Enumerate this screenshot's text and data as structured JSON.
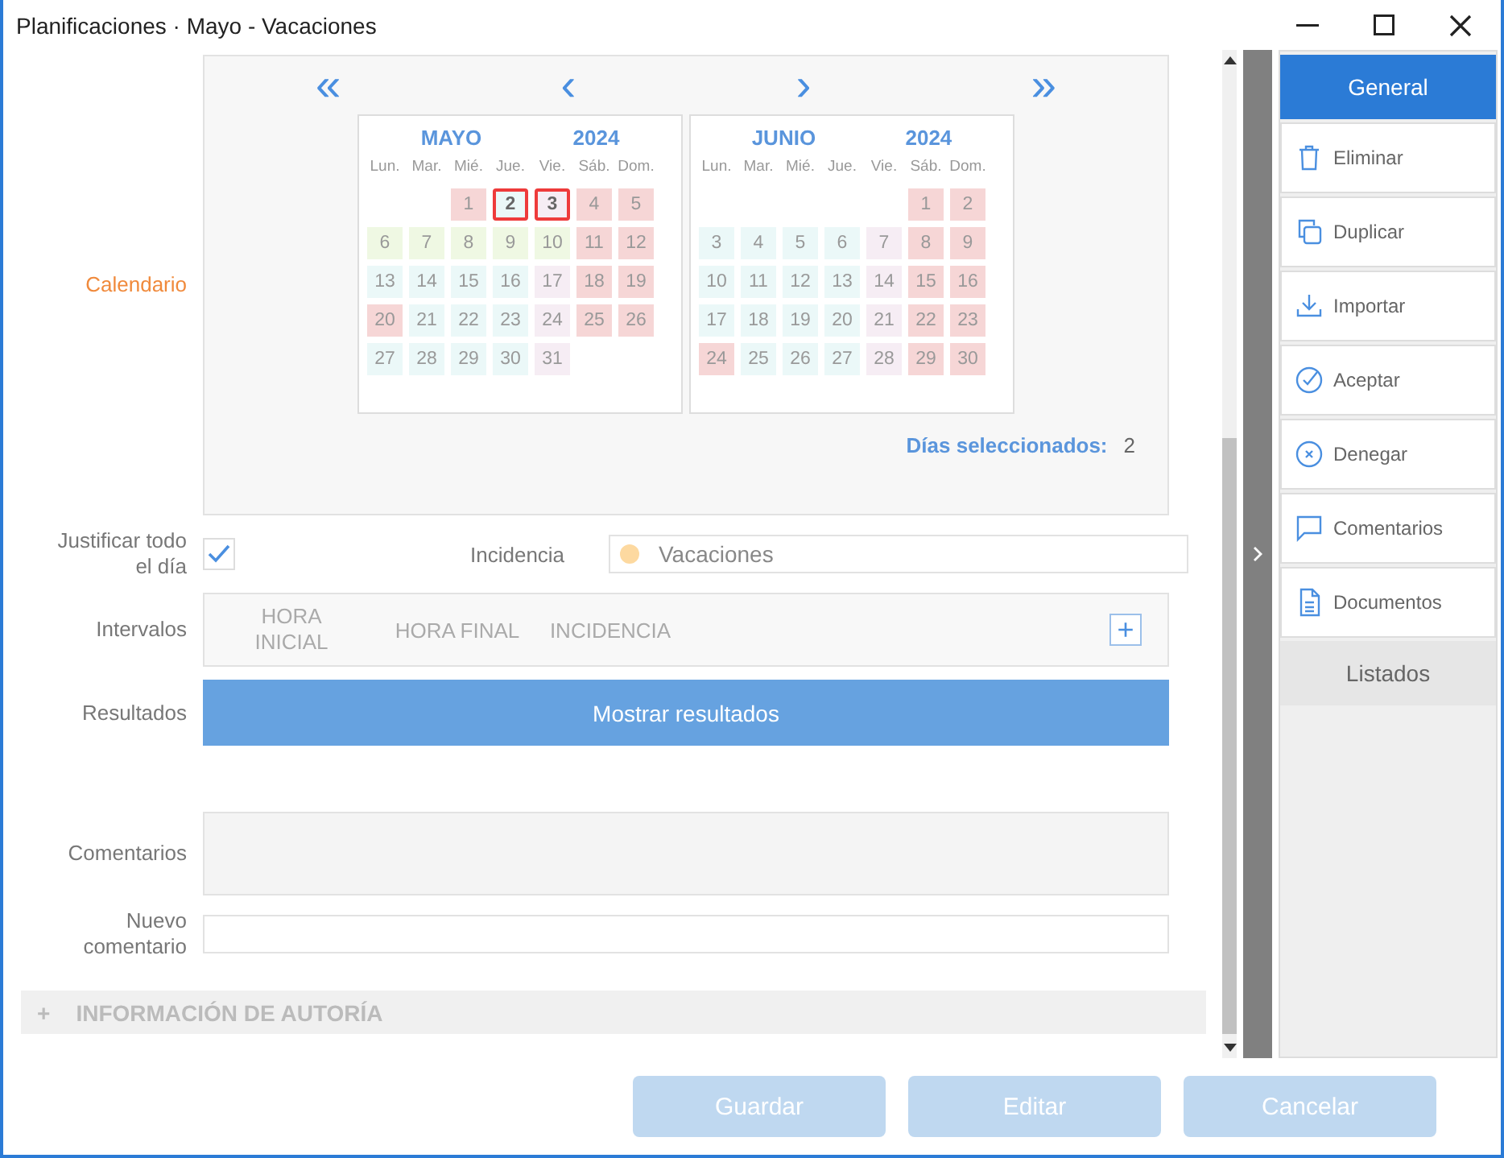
{
  "window": {
    "title": "Planificaciones · Mayo - Vacaciones"
  },
  "calendar": {
    "label": "Calendario",
    "nav": [
      "«",
      "‹",
      "›",
      "»"
    ],
    "months": [
      {
        "month": "MAYO",
        "year": "2024",
        "weekdays": [
          "Lun.",
          "Mar.",
          "Mié.",
          "Jue.",
          "Vie.",
          "Sáb.",
          "Dom."
        ],
        "cells": [
          {
            "kind": "empty"
          },
          {
            "kind": "empty"
          },
          {
            "kind": "day",
            "d": "1",
            "color": "#f6d6d6",
            "selected": false
          },
          {
            "kind": "day",
            "d": "2",
            "color": "#ebf8f8",
            "selected": true
          },
          {
            "kind": "day",
            "d": "3",
            "color": "#f6edf4",
            "selected": true
          },
          {
            "kind": "day",
            "d": "4",
            "color": "#f6d6d6",
            "selected": false
          },
          {
            "kind": "day",
            "d": "5",
            "color": "#f6d6d6",
            "selected": false
          },
          {
            "kind": "day",
            "d": "6",
            "color": "#eff8e3",
            "selected": false
          },
          {
            "kind": "day",
            "d": "7",
            "color": "#eff8e3",
            "selected": false
          },
          {
            "kind": "day",
            "d": "8",
            "color": "#eff8e3",
            "selected": false
          },
          {
            "kind": "day",
            "d": "9",
            "color": "#eff8e3",
            "selected": false
          },
          {
            "kind": "day",
            "d": "10",
            "color": "#eff8e3",
            "selected": false
          },
          {
            "kind": "day",
            "d": "11",
            "color": "#f6d6d6",
            "selected": false
          },
          {
            "kind": "day",
            "d": "12",
            "color": "#f6d6d6",
            "selected": false
          },
          {
            "kind": "day",
            "d": "13",
            "color": "#ebf8f8",
            "selected": false
          },
          {
            "kind": "day",
            "d": "14",
            "color": "#ebf8f8",
            "selected": false
          },
          {
            "kind": "day",
            "d": "15",
            "color": "#ebf8f8",
            "selected": false
          },
          {
            "kind": "day",
            "d": "16",
            "color": "#ebf8f8",
            "selected": false
          },
          {
            "kind": "day",
            "d": "17",
            "color": "#f6edf4",
            "selected": false
          },
          {
            "kind": "day",
            "d": "18",
            "color": "#f6d6d6",
            "selected": false
          },
          {
            "kind": "day",
            "d": "19",
            "color": "#f6d6d6",
            "selected": false
          },
          {
            "kind": "day",
            "d": "20",
            "color": "#f6d6d6",
            "selected": false
          },
          {
            "kind": "day",
            "d": "21",
            "color": "#ebf8f8",
            "selected": false
          },
          {
            "kind": "day",
            "d": "22",
            "color": "#ebf8f8",
            "selected": false
          },
          {
            "kind": "day",
            "d": "23",
            "color": "#ebf8f8",
            "selected": false
          },
          {
            "kind": "day",
            "d": "24",
            "color": "#f6edf4",
            "selected": false
          },
          {
            "kind": "day",
            "d": "25",
            "color": "#f6d6d6",
            "selected": false
          },
          {
            "kind": "day",
            "d": "26",
            "color": "#f6d6d6",
            "selected": false
          },
          {
            "kind": "day",
            "d": "27",
            "color": "#ebf8f8",
            "selected": false
          },
          {
            "kind": "day",
            "d": "28",
            "color": "#ebf8f8",
            "selected": false
          },
          {
            "kind": "day",
            "d": "29",
            "color": "#ebf8f8",
            "selected": false
          },
          {
            "kind": "day",
            "d": "30",
            "color": "#ebf8f8",
            "selected": false
          },
          {
            "kind": "day",
            "d": "31",
            "color": "#f6edf4",
            "selected": false
          }
        ]
      },
      {
        "month": "JUNIO",
        "year": "2024",
        "weekdays": [
          "Lun.",
          "Mar.",
          "Mié.",
          "Jue.",
          "Vie.",
          "Sáb.",
          "Dom."
        ],
        "cells": [
          {
            "kind": "empty"
          },
          {
            "kind": "empty"
          },
          {
            "kind": "empty"
          },
          {
            "kind": "empty"
          },
          {
            "kind": "empty"
          },
          {
            "kind": "day",
            "d": "1",
            "color": "#f6d6d6",
            "selected": false
          },
          {
            "kind": "day",
            "d": "2",
            "color": "#f6d6d6",
            "selected": false
          },
          {
            "kind": "day",
            "d": "3",
            "color": "#ebf8f8",
            "selected": false
          },
          {
            "kind": "day",
            "d": "4",
            "color": "#ebf8f8",
            "selected": false
          },
          {
            "kind": "day",
            "d": "5",
            "color": "#ebf8f8",
            "selected": false
          },
          {
            "kind": "day",
            "d": "6",
            "color": "#ebf8f8",
            "selected": false
          },
          {
            "kind": "day",
            "d": "7",
            "color": "#f6edf4",
            "selected": false
          },
          {
            "kind": "day",
            "d": "8",
            "color": "#f6d6d6",
            "selected": false
          },
          {
            "kind": "day",
            "d": "9",
            "color": "#f6d6d6",
            "selected": false
          },
          {
            "kind": "day",
            "d": "10",
            "color": "#ebf8f8",
            "selected": false
          },
          {
            "kind": "day",
            "d": "11",
            "color": "#ebf8f8",
            "selected": false
          },
          {
            "kind": "day",
            "d": "12",
            "color": "#ebf8f8",
            "selected": false
          },
          {
            "kind": "day",
            "d": "13",
            "color": "#ebf8f8",
            "selected": false
          },
          {
            "kind": "day",
            "d": "14",
            "color": "#f6edf4",
            "selected": false
          },
          {
            "kind": "day",
            "d": "15",
            "color": "#f6d6d6",
            "selected": false
          },
          {
            "kind": "day",
            "d": "16",
            "color": "#f6d6d6",
            "selected": false
          },
          {
            "kind": "day",
            "d": "17",
            "color": "#ebf8f8",
            "selected": false
          },
          {
            "kind": "day",
            "d": "18",
            "color": "#ebf8f8",
            "selected": false
          },
          {
            "kind": "day",
            "d": "19",
            "color": "#ebf8f8",
            "selected": false
          },
          {
            "kind": "day",
            "d": "20",
            "color": "#ebf8f8",
            "selected": false
          },
          {
            "kind": "day",
            "d": "21",
            "color": "#f6edf4",
            "selected": false
          },
          {
            "kind": "day",
            "d": "22",
            "color": "#f6d6d6",
            "selected": false
          },
          {
            "kind": "day",
            "d": "23",
            "color": "#f6d6d6",
            "selected": false
          },
          {
            "kind": "day",
            "d": "24",
            "color": "#f6d6d6",
            "selected": false
          },
          {
            "kind": "day",
            "d": "25",
            "color": "#ebf8f8",
            "selected": false
          },
          {
            "kind": "day",
            "d": "26",
            "color": "#ebf8f8",
            "selected": false
          },
          {
            "kind": "day",
            "d": "27",
            "color": "#ebf8f8",
            "selected": false
          },
          {
            "kind": "day",
            "d": "28",
            "color": "#f6edf4",
            "selected": false
          },
          {
            "kind": "day",
            "d": "29",
            "color": "#f6d6d6",
            "selected": false
          },
          {
            "kind": "day",
            "d": "30",
            "color": "#f6d6d6",
            "selected": false
          }
        ]
      }
    ],
    "selected_label": "Días seleccionados:",
    "selected_count": "2"
  },
  "justify": {
    "label": "Justificar todo el día",
    "checked": true
  },
  "incidencia": {
    "label": "Incidencia",
    "value": "Vacaciones",
    "color": "#fdd9a0"
  },
  "intervalos": {
    "label": "Intervalos",
    "columns": [
      "HORA INICIAL",
      "HORA FINAL",
      "INCIDENCIA"
    ],
    "add": "+"
  },
  "resultados": {
    "label": "Resultados",
    "button": "Mostrar resultados"
  },
  "comentarios": {
    "label": "Comentarios"
  },
  "nuevo_comentario": {
    "label": "Nuevo comentario"
  },
  "section": {
    "toggle": "+",
    "title": "INFORMACIÓN DE AUTORÍA",
    "expanded": false
  },
  "buttons": [
    {
      "label": "Guardar",
      "disabled": true
    },
    {
      "label": "Editar",
      "disabled": true
    },
    {
      "label": "Cancelar",
      "disabled": true
    }
  ],
  "sidebar": {
    "items": [
      {
        "kind": "tab",
        "label": "General",
        "selected": true
      },
      {
        "kind": "action",
        "label": "Eliminar"
      },
      {
        "kind": "action",
        "label": "Duplicar"
      },
      {
        "kind": "action",
        "label": "Importar"
      },
      {
        "kind": "action",
        "label": "Aceptar"
      },
      {
        "kind": "action",
        "label": "Denegar"
      },
      {
        "kind": "action",
        "label": "Comentarios"
      },
      {
        "kind": "action",
        "label": "Documentos"
      },
      {
        "kind": "tab",
        "label": "Listados",
        "selected": false
      }
    ]
  }
}
